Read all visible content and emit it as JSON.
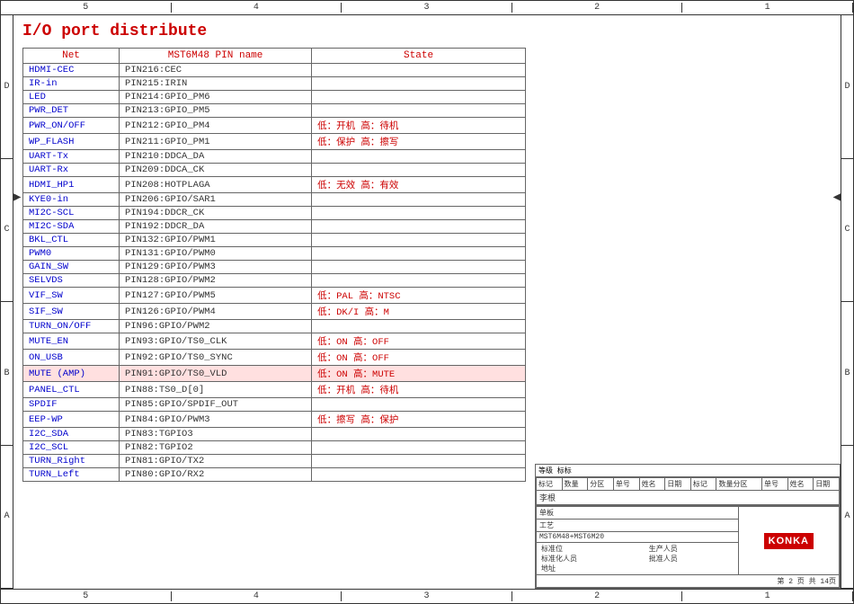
{
  "title": "I/O port distribute",
  "table": {
    "headers": [
      "Net",
      "MST6M48 PIN name",
      "State"
    ],
    "rows": [
      {
        "net": "HDMI-CEC",
        "pin": "PIN216:CEC",
        "state": ""
      },
      {
        "net": "IR-in",
        "pin": "PIN215:IRIN",
        "state": ""
      },
      {
        "net": "LED",
        "pin": "PIN214:GPIO_PM6",
        "state": ""
      },
      {
        "net": "PWR_DET",
        "pin": "PIN213:GPIO_PM5",
        "state": ""
      },
      {
        "net": "PWR_ON/OFF",
        "pin": "PIN212:GPIO_PM4",
        "state": "低：开机   高：待机"
      },
      {
        "net": "WP_FLASH",
        "pin": "PIN211:GPIO_PM1",
        "state": "低：保护   高：擦写"
      },
      {
        "net": "UART-Tx",
        "pin": "PIN210:DDCA_DA",
        "state": ""
      },
      {
        "net": "UART-Rx",
        "pin": "PIN209:DDCA_CK",
        "state": ""
      },
      {
        "net": "HDMI_HP1",
        "pin": "PIN208:HOTPLAGA",
        "state": "低：无效   高：有效"
      },
      {
        "net": "KYE0-in",
        "pin": "PIN206:GPIO/SAR1",
        "state": ""
      },
      {
        "net": "MI2C-SCL",
        "pin": "PIN194:DDCR_CK",
        "state": ""
      },
      {
        "net": "MI2C-SDA",
        "pin": "PIN192:DDCR_DA",
        "state": ""
      },
      {
        "net": "BKL_CTL",
        "pin": "PIN132:GPIO/PWM1",
        "state": ""
      },
      {
        "net": "PWM0",
        "pin": "PIN131:GPIO/PWM0",
        "state": ""
      },
      {
        "net": "GAIN_SW",
        "pin": "PIN129:GPIO/PWM3",
        "state": ""
      },
      {
        "net": "SELVDS",
        "pin": "PIN128:GPIO/PWM2",
        "state": ""
      },
      {
        "net": "VIF_SW",
        "pin": "PIN127:GPIO/PWM5",
        "state": "低：PAL   高：NTSC"
      },
      {
        "net": "SIF_SW",
        "pin": "PIN126:GPIO/PWM4",
        "state": "低：DK/I  高：M"
      },
      {
        "net": "TURN_ON/OFF",
        "pin": "PIN96:GPIO/PWM2",
        "state": ""
      },
      {
        "net": "MUTE_EN",
        "pin": "PIN93:GPIO/TS0_CLK",
        "state": "低：ON    高：OFF"
      },
      {
        "net": "ON_USB",
        "pin": "PIN92:GPIO/TS0_SYNC",
        "state": "低：ON    高：OFF"
      },
      {
        "net": "MUTE (AMP)",
        "pin": "PIN91:GPIO/TS0_VLD",
        "state": "低：ON    高：MUTE"
      },
      {
        "net": "PANEL_CTL",
        "pin": "PIN88:TS0_D[0]",
        "state": "低：开机  高：待机"
      },
      {
        "net": "SPDIF",
        "pin": "PIN85:GPIO/SPDIF_OUT",
        "state": ""
      },
      {
        "net": "EEP-WP",
        "pin": "PIN84:GPIO/PWM3",
        "state": "低：擦写   高：保护"
      },
      {
        "net": "I2C_SDA",
        "pin": "PIN83:TGPIO3",
        "state": ""
      },
      {
        "net": "I2C_SCL",
        "pin": "PIN82:TGPIO2",
        "state": ""
      },
      {
        "net": "TURN_Right",
        "pin": "PIN81:GPIO/TX2",
        "state": ""
      },
      {
        "net": "TURN_Left",
        "pin": "PIN80:GPIO/RX2",
        "state": ""
      }
    ]
  },
  "ruler": {
    "top": [
      "5",
      "4",
      "3",
      "2",
      "1"
    ],
    "bottom": [
      "5",
      "4",
      "3",
      "2",
      "1"
    ]
  },
  "side_labels": {
    "left": [
      "D",
      "C",
      "B",
      "A"
    ],
    "right": [
      "D",
      "C",
      "B",
      "A"
    ]
  },
  "bottom_info": {
    "labels_row1": [
      "标记",
      "数量",
      "分区",
      "单号",
      "姓名",
      "日期",
      "标记",
      "数量分区",
      "单号",
      "姓名",
      "日期"
    ],
    "designer": "李根",
    "company": "单板",
    "work": "工艺",
    "factory": "生产人员",
    "location": "标准位",
    "check": "标准化人员",
    "address": "地址",
    "approve": "批准人员",
    "model": "MST6M48+MST6M20",
    "brand": "KONKA",
    "page": "第 2 页  共 14页",
    "grade_label": "等级  标标",
    "page_label": "第 2 页  共 14页"
  }
}
